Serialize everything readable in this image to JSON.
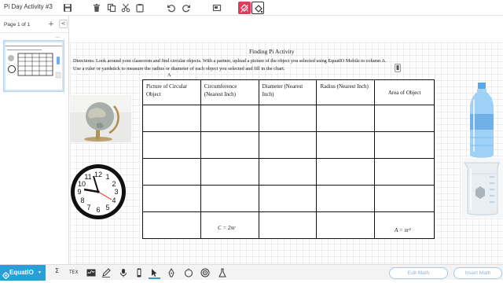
{
  "app": {
    "doc_title": "Pi Day Activity #3"
  },
  "toolbar": {
    "icons": [
      "save-icon",
      "trash-icon",
      "copy-icon",
      "cut-icon",
      "paste-icon",
      "undo-icon",
      "redo-icon",
      "screenshot-icon",
      "fill-active-icon",
      "fill-icon"
    ],
    "accent_active": "#e8365c"
  },
  "panel": {
    "page_count": "Page 1 of 1",
    "add_label": "+",
    "collapse_label": "<",
    "menu_label": "..."
  },
  "document": {
    "heading": "Finding Pi Activity",
    "directions_1": "Directions: Look around your classroom and find circular objects.  With a partner, upload a picture of the object you selected using EquatIO Mobile to column A.",
    "directions_2": "Use a ruler or yardstick to measure the radius or diameter of each object you selected and fill in the chart.",
    "column_letter": "A",
    "table": {
      "headers": [
        "Picture of Circular Object",
        "Circumference (Nearest Inch)",
        "Diameter (Nearest Inch)",
        "Radius (Nearest Inch)",
        "Area of Object"
      ],
      "rows": [
        [
          "",
          "",
          "",
          "",
          ""
        ],
        [
          "",
          "",
          "",
          "",
          ""
        ],
        [
          "",
          "",
          "",
          "",
          ""
        ],
        [
          "",
          "",
          "",
          "",
          ""
        ],
        [
          "",
          "",
          "",
          "",
          ""
        ]
      ]
    },
    "formula_circumference": "C = 2πr",
    "formula_area": "A = πr²",
    "images": [
      "globe",
      "wall-clock",
      "water-bottle",
      "glass-beaker"
    ]
  },
  "bottombar": {
    "brand": "EquatIO",
    "tools": [
      "math-sigma-icon",
      "latex-icon",
      "handwriting-icon",
      "pen-icon",
      "microphone-icon",
      "mobile-icon",
      "pointer-icon",
      "pen-tool-icon",
      "marker-icon",
      "apple-icon",
      "target-icon",
      "flask-icon"
    ],
    "latex_label": "TEX",
    "edit_math": "Edit Math",
    "insert_math": "Insert Math",
    "brand_color": "#2a9fd6"
  }
}
